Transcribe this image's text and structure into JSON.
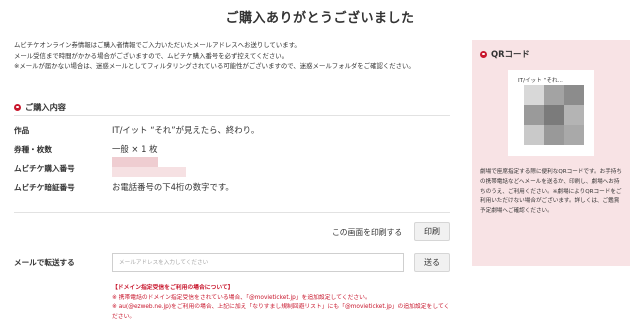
{
  "page": {
    "title": "ご購入ありがとうございました"
  },
  "intro": {
    "line1": "ムビチケオンライン券情報はご購入者情報でご入力いただいたメールアドレスへお送りしています。",
    "line2": "メール受信まで時間がかかる場合がございますので、ムビチケ購入番号を必ず控えてください。",
    "line3": "※メールが届かない場合は、迷惑メールとしてフィルタリングされている可能性がございますので、迷惑メールフォルダをご確認ください。"
  },
  "details": {
    "heading": "ご購入内容",
    "rows": [
      {
        "label": "作品",
        "value": "IT/イット “それ”が見えたら、終わり。"
      },
      {
        "label": "券種・枚数",
        "value": "一般 × 1 枚"
      },
      {
        "label": "ムビチケ購入番号",
        "value": ""
      },
      {
        "label": "ムビチケ暗証番号",
        "value": "お電話番号の下4桁の数字です。"
      }
    ]
  },
  "print": {
    "text": "この画面を印刷する",
    "button": "印刷"
  },
  "mail": {
    "label": "メールで転送する",
    "placeholder": "メールアドレスを入力してください",
    "value": "",
    "button": "送る"
  },
  "notice": {
    "title": "【ドメイン指定受信をご利用の場合について】",
    "line1": "※ 携帯電話のドメイン指定受信をされている場合、「@movieticket.jp」を追加設定してください。",
    "line2": "※ au(@ezweb.ne.jp)をご利用の場合、上記に加え「なりすまし規制回避リスト」にも「@movieticket.jp」の追加設定をしてください。"
  },
  "qr": {
    "heading": "QRコード",
    "caption": "IT/イット “それ...",
    "description": "劇場で座席指定する際に便利なQRコードです。お手持ちの携帯電話などへメールを送るか、印刷し、劇場へお持ちのうえ、ご利用ください。※劇場によりQRコードをご利用いただけない場合がございます。詳しくは、ご鑑賞予定劇場へご確認ください。"
  },
  "colors": {
    "accent": "#c8162c",
    "panel": "#f8e3e5",
    "redacted": "#f6e1e3"
  },
  "icons": {
    "section_bullet": "circle-bullet-icon"
  }
}
